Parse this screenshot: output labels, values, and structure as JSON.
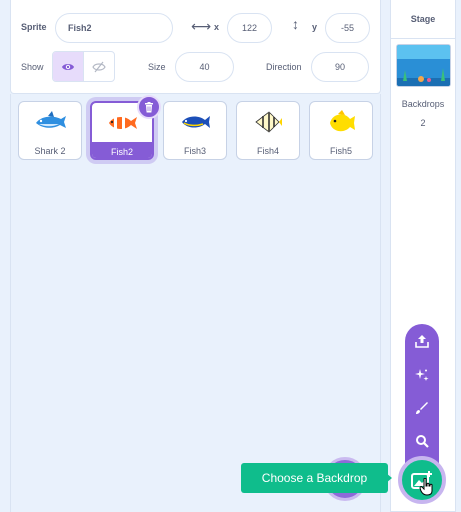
{
  "sprite_info": {
    "sprite_label": "Sprite",
    "sprite_name": "Fish2",
    "x_label": "x",
    "x_value": "122",
    "y_label": "y",
    "y_value": "-55",
    "show_label": "Show",
    "size_label": "Size",
    "size_value": "40",
    "direction_label": "Direction",
    "direction_value": "90"
  },
  "sprites": [
    {
      "name": "Shark 2",
      "icon": "shark-icon",
      "selected": false
    },
    {
      "name": "Fish2",
      "icon": "clownfish-icon",
      "selected": true
    },
    {
      "name": "Fish3",
      "icon": "blue-fish-icon",
      "selected": false
    },
    {
      "name": "Fish4",
      "icon": "angelfish-icon",
      "selected": false
    },
    {
      "name": "Fish5",
      "icon": "yellow-fish-icon",
      "selected": false
    }
  ],
  "stage": {
    "title": "Stage",
    "backdrops_label": "Backdrops",
    "backdrops_count": "2"
  },
  "backdrop_menu": {
    "items": [
      "upload-icon",
      "surprise-icon",
      "paint-icon",
      "search-icon"
    ],
    "tooltip": "Choose a Backdrop"
  },
  "colors": {
    "accent": "#855cd6",
    "green": "#0fbd8c",
    "text": "#575e75",
    "background": "#e9f1fc"
  }
}
